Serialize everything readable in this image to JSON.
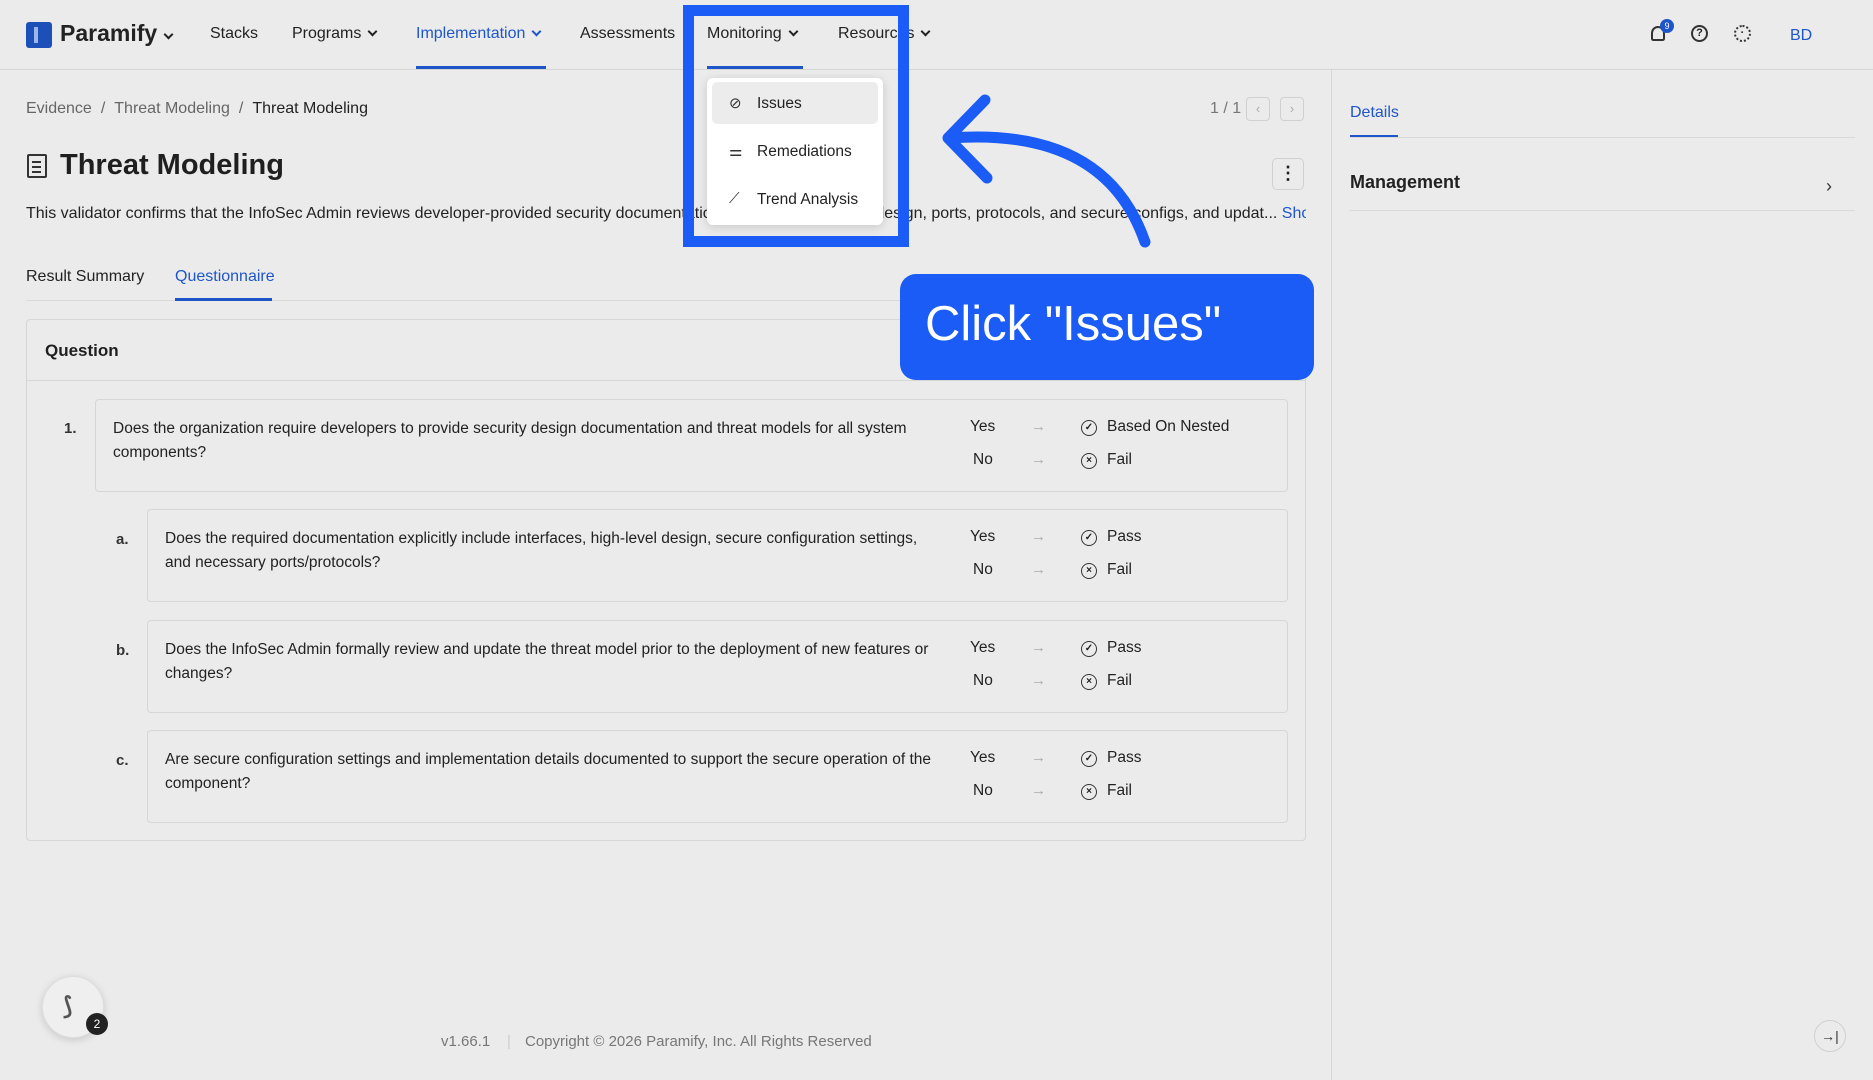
{
  "app": {
    "name": "Paramify"
  },
  "nav": {
    "items": [
      "Stacks",
      "Programs",
      "Implementation",
      "Assessments",
      "Monitoring",
      "Resources"
    ],
    "notification_count": "9",
    "avatar_initials": "BD"
  },
  "breadcrumb": [
    "Evidence",
    "Threat Modeling",
    "Threat Modeling"
  ],
  "pager": {
    "text": "1 / 1"
  },
  "page": {
    "title": "Threat Modeling",
    "description": "This validator confirms that the InfoSec Admin reviews developer-provided security documentation, including interfaces, design, ports, protocols, and secure configs, and updat...",
    "show_more": "Show More"
  },
  "tabs": [
    "Result Summary",
    "Questionnaire"
  ],
  "questionnaire": {
    "header": "Question",
    "questions": [
      {
        "num": "1.",
        "text": "Does the organization require developers to provide security design documentation and threat models for all system components?",
        "answers": [
          {
            "answer": "Yes",
            "result": "Based On Nested",
            "status": "check"
          },
          {
            "answer": "No",
            "result": "Fail",
            "status": "x"
          }
        ]
      },
      {
        "num": "a.",
        "text": "Does the required documentation explicitly include interfaces, high-level design, secure configuration settings, and necessary ports/protocols?",
        "answers": [
          {
            "answer": "Yes",
            "result": "Pass",
            "status": "check"
          },
          {
            "answer": "No",
            "result": "Fail",
            "status": "x"
          }
        ]
      },
      {
        "num": "b.",
        "text": "Does the InfoSec Admin formally review and update the threat model prior to the deployment of new features or changes?",
        "answers": [
          {
            "answer": "Yes",
            "result": "Pass",
            "status": "check"
          },
          {
            "answer": "No",
            "result": "Fail",
            "status": "x"
          }
        ]
      },
      {
        "num": "c.",
        "text": "Are secure configuration settings and implementation details documented to support the secure operation of the component?",
        "answers": [
          {
            "answer": "Yes",
            "result": "Pass",
            "status": "check"
          },
          {
            "answer": "No",
            "result": "Fail",
            "status": "x"
          }
        ]
      }
    ]
  },
  "right_panel": {
    "tab": "Details",
    "section": "Management"
  },
  "monitoring_menu": {
    "items": [
      "Issues",
      "Remediations",
      "Trend Analysis"
    ]
  },
  "callout": {
    "text": "Click \"Issues\""
  },
  "footer": {
    "version": "v1.66.1",
    "copyright": "Copyright © 2026 Paramify, Inc. All Rights Reserved"
  },
  "float_badge": "2",
  "colors": {
    "accent": "#1e56c9",
    "callout": "#1a5cf5"
  }
}
